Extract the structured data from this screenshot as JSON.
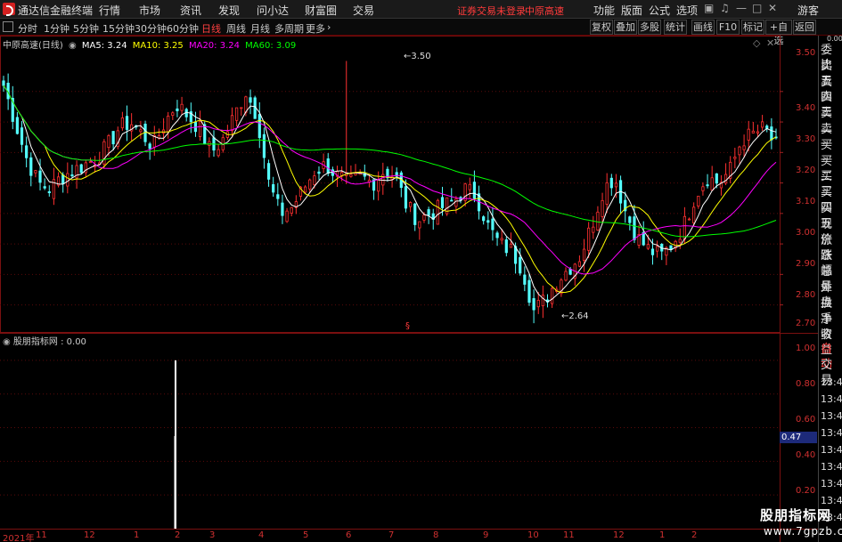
{
  "app": {
    "title": "通达信金融终端"
  },
  "menu": [
    "行情",
    "市场",
    "资讯",
    "发现",
    "问小达",
    "财富圈",
    "交易"
  ],
  "status": {
    "login": "证券交易未登录",
    "stock": "中原高速"
  },
  "right_menu": [
    "功能",
    "版面",
    "公式",
    "选项"
  ],
  "guest": "游客",
  "periods": [
    "分时",
    "1分钟",
    "5分钟",
    "15分钟",
    "30分钟",
    "60分钟",
    "日线",
    "周线",
    "月线",
    "多周期",
    "更多"
  ],
  "active_period": "日线",
  "tools": [
    "复权",
    "叠加",
    "多股",
    "统计",
    "画线",
    "F10",
    "标记",
    "+自选",
    "返回"
  ],
  "legend": {
    "name": "中原高速(日线)",
    "ma5": "MA5: 3.24",
    "ma10": "MA10: 3.25",
    "ma20": "MA20: 3.24",
    "ma60": "MA60: 3.09"
  },
  "colors": {
    "ma5": "#ffffff",
    "ma10": "#ffff00",
    "ma20": "#ff00ff",
    "ma60": "#00ff00",
    "up": "#ff3030",
    "down": "#54ffff",
    "accent": "#ff3b3b"
  },
  "price_axis": [
    "3.50",
    "3.40",
    "3.30",
    "3.20",
    "3.10",
    "3.00",
    "2.90",
    "2.80",
    "2.70"
  ],
  "annotations": {
    "high": "3.50",
    "low": "2.64"
  },
  "sub": {
    "legend": "股朋指标网 : 0.00",
    "axis": [
      "1.00",
      "0.80",
      "0.60",
      "0.40",
      "0.20"
    ],
    "current": "0.47"
  },
  "x_axis": [
    "2021年",
    "11",
    "12",
    "1",
    "2",
    "3",
    "4",
    "5",
    "6",
    "7",
    "8",
    "9",
    "10",
    "11",
    "12",
    "1",
    "2"
  ],
  "right_panel": {
    "top": "0.00",
    "labels": [
      "委比",
      "卖五",
      "卖四",
      "卖三",
      "卖二",
      "卖一",
      "买一",
      "买二",
      "买三",
      "买四",
      "买五",
      "现价",
      "涨跌",
      "涨幅",
      "总量",
      "外盘",
      "换手",
      "净资",
      "收益"
    ],
    "auto": "自动",
    "trade": "交易",
    "times": [
      "13:44",
      "13:44",
      "13:44",
      "13:45",
      "13:45",
      "13:45",
      "13:45",
      "13:45",
      "13:46"
    ]
  },
  "watermark": {
    "line1": "股朋指标网",
    "line2": "www.7gpzb.com"
  },
  "chart_data": {
    "type": "candlestick",
    "title": "中原高速(日线)",
    "ylim": [
      2.62,
      3.56
    ],
    "close_approx": [
      3.42,
      3.3,
      3.18,
      3.1,
      3.08,
      3.12,
      3.14,
      3.16,
      3.18,
      3.22,
      3.28,
      3.3,
      3.26,
      3.22,
      3.3,
      3.36,
      3.32,
      3.28,
      3.2,
      3.24,
      3.32,
      3.4,
      3.32,
      3.1,
      3.0,
      3.02,
      3.08,
      3.14,
      3.16,
      3.12,
      3.1,
      3.12,
      3.1,
      3.14,
      3.12,
      3.02,
      2.98,
      3.0,
      3.02,
      3.04,
      3.08,
      3.06,
      2.96,
      2.9,
      2.88,
      2.82,
      2.68,
      2.72,
      2.78,
      2.82,
      2.86,
      2.96,
      3.08,
      3.12,
      3.0,
      2.92,
      2.88,
      2.86,
      2.9,
      2.96,
      3.06,
      3.12,
      3.1,
      3.14,
      3.24,
      3.26,
      3.28,
      3.22
    ],
    "high": 3.5,
    "low": 2.64,
    "series": [
      {
        "name": "MA5",
        "value": 3.24
      },
      {
        "name": "MA10",
        "value": 3.25
      },
      {
        "name": "MA20",
        "value": 3.24
      },
      {
        "name": "MA60",
        "value": 3.09
      }
    ],
    "indicator": {
      "name": "股朋指标网",
      "value": 0.0,
      "ylim": [
        0,
        1.1
      ],
      "spike_index": 17,
      "spike_value": 1.0
    }
  }
}
